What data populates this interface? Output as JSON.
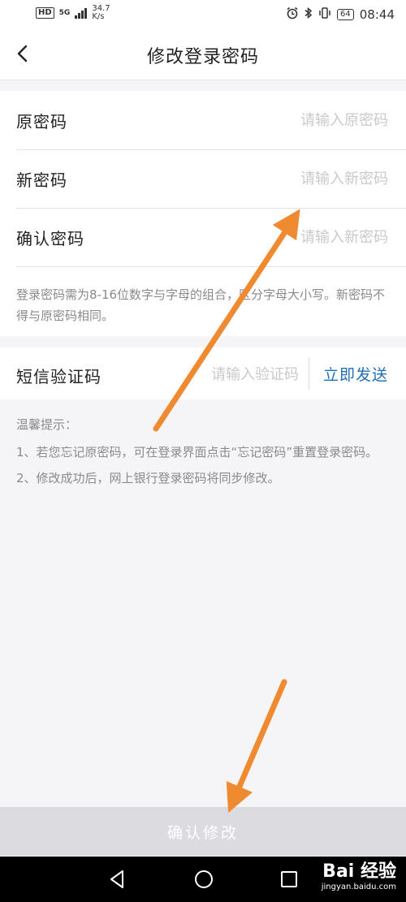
{
  "status_bar": {
    "hd": "HD",
    "network_type": "5G",
    "speed_value": "34.7",
    "speed_unit": "K/s",
    "battery": "64",
    "time": "08:44"
  },
  "nav": {
    "title": "修改登录密码"
  },
  "form": {
    "old_password": {
      "label": "原密码",
      "placeholder": "请输入原密码",
      "value": ""
    },
    "new_password": {
      "label": "新密码",
      "placeholder": "请输入新密码",
      "value": ""
    },
    "confirm_password": {
      "label": "确认密码",
      "placeholder": "请输入新密码",
      "value": ""
    },
    "hint": "登录密码需为8-16位数字与字母的组合，区分字母大小写。新密码不得与原密码相同。"
  },
  "sms": {
    "label": "短信验证码",
    "placeholder": "请输入验证码",
    "value": "",
    "send_label": "立即发送"
  },
  "tips": {
    "title": "温馨提示：",
    "items": [
      "1、若您忘记原密码，可在登录界面点击“忘记密码”重置登录密码。",
      "2、修改成功后，网上银行登录密码将同步修改。"
    ]
  },
  "confirm_button": {
    "label": "确认修改"
  },
  "watermark": {
    "logo": "Bai 经验",
    "url": "jingyan.baidu.com"
  },
  "colors": {
    "link_blue": "#1f6fb8",
    "annotation_orange": "#f08a30",
    "disabled_button": "#dcdce0"
  },
  "icons": {
    "back": "chevron-left-icon",
    "alarm": "alarm-icon",
    "bluetooth": "bluetooth-icon",
    "vibrate": "vibrate-icon",
    "nav_back": "triangle-back-icon",
    "nav_home": "circle-home-icon",
    "nav_recent": "square-recent-icon"
  }
}
